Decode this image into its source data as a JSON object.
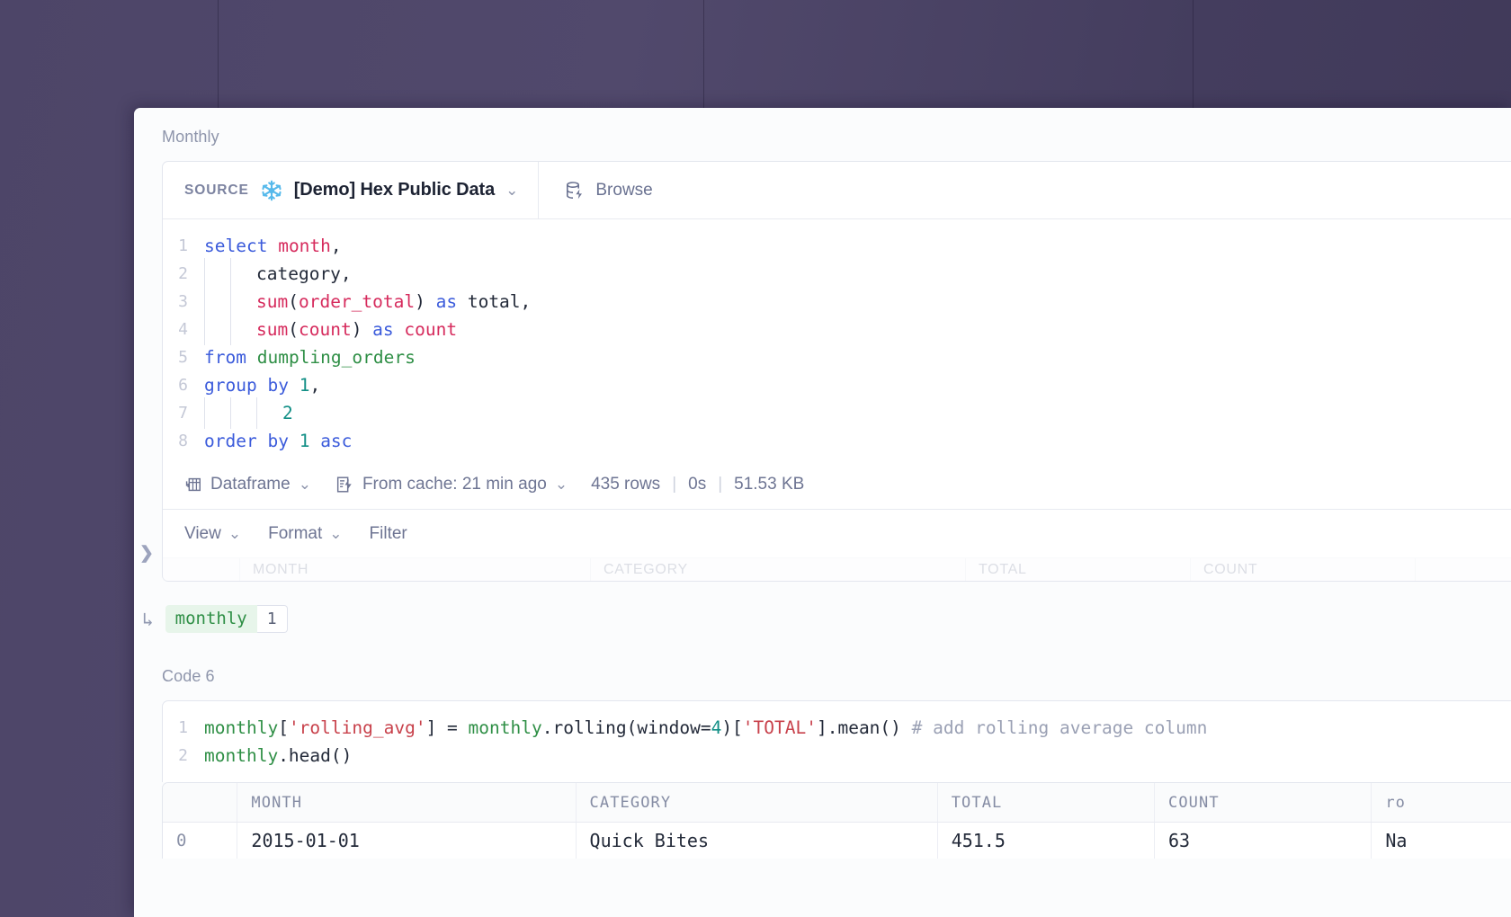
{
  "workspace": {
    "background_color": "#4b4466",
    "expand_handle_icon": "chevron-right-icon"
  },
  "sql_cell": {
    "label": "Monthly",
    "source": {
      "label": "SOURCE",
      "connection_icon": "snowflake-icon",
      "connection_name": "[Demo] Hex Public Data",
      "dropdown_icon": "chevron-down-icon"
    },
    "browse": {
      "label": "Browse",
      "icon": "database-lightning-icon"
    },
    "code_lines": [
      {
        "n": "1",
        "indent": 0,
        "tokens": [
          {
            "t": "select",
            "c": "k"
          },
          {
            "t": " ",
            "c": ""
          },
          {
            "t": "month",
            "c": "f"
          },
          {
            "t": ",",
            "c": ""
          }
        ]
      },
      {
        "n": "2",
        "indent": 2,
        "tokens": [
          {
            "t": "category,",
            "c": ""
          }
        ]
      },
      {
        "n": "3",
        "indent": 2,
        "tokens": [
          {
            "t": "sum",
            "c": "f"
          },
          {
            "t": "(",
            "c": ""
          },
          {
            "t": "order_total",
            "c": "f"
          },
          {
            "t": ") ",
            "c": ""
          },
          {
            "t": "as",
            "c": "k"
          },
          {
            "t": " total,",
            "c": ""
          }
        ]
      },
      {
        "n": "4",
        "indent": 2,
        "tokens": [
          {
            "t": "sum",
            "c": "f"
          },
          {
            "t": "(",
            "c": ""
          },
          {
            "t": "count",
            "c": "f"
          },
          {
            "t": ") ",
            "c": ""
          },
          {
            "t": "as",
            "c": "k"
          },
          {
            "t": " ",
            "c": ""
          },
          {
            "t": "count",
            "c": "f"
          }
        ]
      },
      {
        "n": "5",
        "indent": 0,
        "tokens": [
          {
            "t": "from",
            "c": "k"
          },
          {
            "t": " ",
            "c": ""
          },
          {
            "t": "dumpling_orders",
            "c": "t"
          }
        ]
      },
      {
        "n": "6",
        "indent": 0,
        "tokens": [
          {
            "t": "group",
            "c": "k"
          },
          {
            "t": " ",
            "c": ""
          },
          {
            "t": "by",
            "c": "k"
          },
          {
            "t": " ",
            "c": ""
          },
          {
            "t": "1",
            "c": "n"
          },
          {
            "t": ",",
            "c": ""
          }
        ]
      },
      {
        "n": "7",
        "indent": 3,
        "tokens": [
          {
            "t": "2",
            "c": "n"
          }
        ]
      },
      {
        "n": "8",
        "indent": 0,
        "tokens": [
          {
            "t": "order",
            "c": "k"
          },
          {
            "t": " ",
            "c": ""
          },
          {
            "t": "by",
            "c": "k"
          },
          {
            "t": " ",
            "c": ""
          },
          {
            "t": "1",
            "c": "n"
          },
          {
            "t": " ",
            "c": ""
          },
          {
            "t": "asc",
            "c": "k"
          }
        ]
      }
    ],
    "status": {
      "result_type": "Dataframe",
      "result_type_icon": "dataframe-icon",
      "cache": "From cache: 21 min ago",
      "cache_icon": "cache-lightning-icon",
      "rows": "435 rows",
      "duration": "0s",
      "size": "51.53 KB",
      "separator": "|"
    },
    "table_toolbar": {
      "view": "View",
      "format": "Format",
      "filter": "Filter"
    },
    "ghost_headers": [
      "MONTH",
      "CATEGORY",
      "TOTAL",
      "COUNT"
    ],
    "output": {
      "arrow": "↳",
      "variable": "monthly",
      "count": "1"
    }
  },
  "python_cell": {
    "label": "Code 6",
    "code_lines": [
      {
        "n": "1",
        "tokens": [
          {
            "t": "monthly",
            "c": "t"
          },
          {
            "t": "[",
            "c": ""
          },
          {
            "t": "'rolling_avg'",
            "c": "s"
          },
          {
            "t": "] = ",
            "c": ""
          },
          {
            "t": "monthly",
            "c": "t"
          },
          {
            "t": ".rolling(window=",
            "c": ""
          },
          {
            "t": "4",
            "c": "n"
          },
          {
            "t": ")[",
            "c": ""
          },
          {
            "t": "'TOTAL'",
            "c": "s"
          },
          {
            "t": "].mean() ",
            "c": ""
          },
          {
            "t": "# add rolling average column",
            "c": "cm"
          }
        ]
      },
      {
        "n": "2",
        "tokens": [
          {
            "t": "monthly",
            "c": "t"
          },
          {
            "t": ".head()",
            "c": ""
          }
        ]
      }
    ],
    "result_table": {
      "columns": [
        "",
        "MONTH",
        "CATEGORY",
        "TOTAL",
        "COUNT",
        "ro"
      ],
      "rows": [
        {
          "index": "0",
          "MONTH": "2015-01-01",
          "CATEGORY": "Quick Bites",
          "TOTAL": "451.5",
          "COUNT": "63",
          "rolling_avg": "Na"
        }
      ]
    }
  }
}
